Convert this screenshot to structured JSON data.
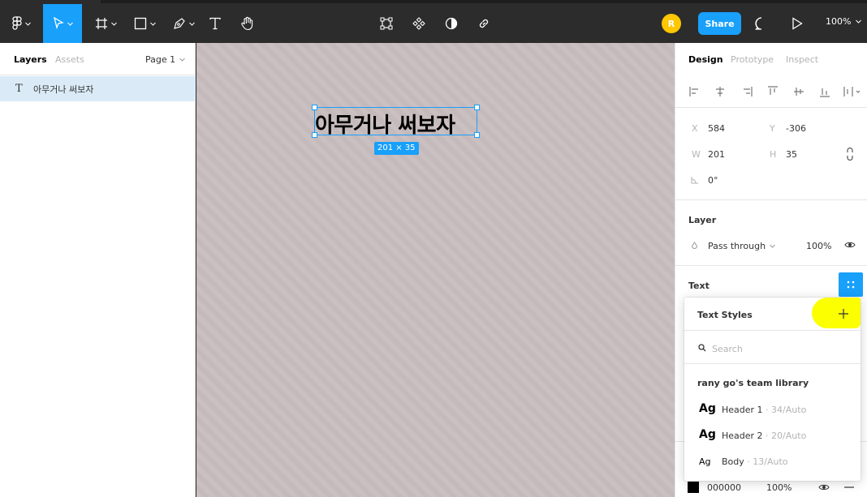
{
  "toolbar": {
    "zoom": "100%",
    "avatar_initial": "R",
    "share_label": "Share"
  },
  "left_panel": {
    "tabs": [
      "Layers",
      "Assets"
    ],
    "page": "Page 1",
    "layers": [
      {
        "name": "아무거나 써보자",
        "type": "text"
      }
    ]
  },
  "canvas": {
    "text": "아무거나 써보자",
    "dimensions": "201 × 35"
  },
  "right_panel": {
    "tabs": [
      "Design",
      "Prototype",
      "Inspect"
    ],
    "position": {
      "x_label": "X",
      "x": "584",
      "y_label": "Y",
      "y": "-306"
    },
    "size": {
      "w_label": "W",
      "w": "201",
      "h_label": "H",
      "h": "35"
    },
    "rotation": "0°",
    "layer": {
      "title": "Layer",
      "blend": "Pass through",
      "opacity": "100%"
    },
    "text_section": {
      "title": "Text"
    },
    "fill": {
      "hex": "000000",
      "opacity": "100%",
      "color": "#000000"
    }
  },
  "text_styles_popup": {
    "title": "Text Styles",
    "search_placeholder": "Search",
    "library": "rany go's team library",
    "styles": [
      {
        "ag": "Ag",
        "name": "Header 1",
        "meta": " · 34/Auto"
      },
      {
        "ag": "Ag",
        "name": "Header 2",
        "meta": " · 20/Auto"
      },
      {
        "ag": "Ag",
        "name": "Body",
        "meta": " · 13/Auto"
      }
    ]
  },
  "colors": {
    "accent": "#18a0fb",
    "highlight": "#fbff00",
    "avatar": "#ffc700"
  }
}
